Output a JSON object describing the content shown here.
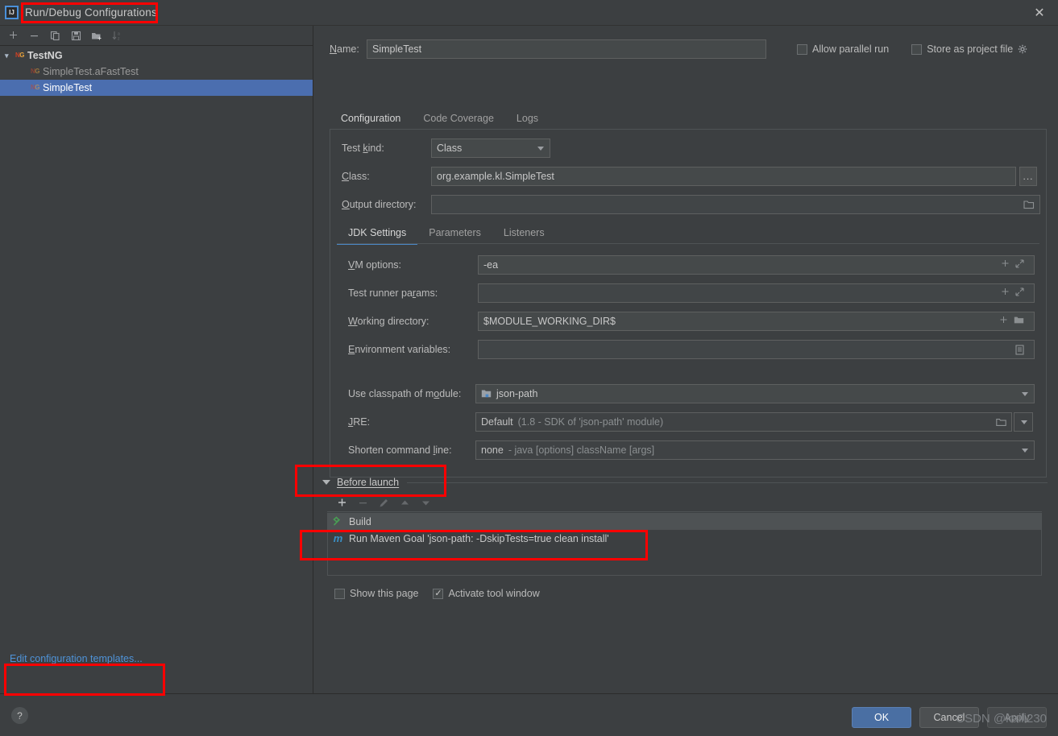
{
  "window": {
    "title": "Run/Debug Configurations",
    "logo_text": "IJ",
    "close_icon": "✕"
  },
  "sidebar": {
    "toolbar": [
      {
        "name": "add",
        "glyph": "+",
        "disabled": false
      },
      {
        "name": "remove",
        "glyph": "−",
        "disabled": false
      },
      {
        "name": "copy",
        "glyph": "copy",
        "disabled": false
      },
      {
        "name": "save",
        "glyph": "save",
        "disabled": false
      },
      {
        "name": "move-to-folder",
        "glyph": "folder-add",
        "disabled": false
      },
      {
        "name": "sort-alphabetically",
        "glyph": "sort-az",
        "disabled": true
      }
    ],
    "tree": [
      {
        "label": "TestNG",
        "level": 1,
        "selected": false,
        "expanded": true,
        "icon": "testng-icon"
      },
      {
        "label": "SimpleTest.aFastTest",
        "level": 2,
        "selected": false,
        "dim": true,
        "icon": "testng-icon"
      },
      {
        "label": "SimpleTest",
        "level": 2,
        "selected": true,
        "dim": false,
        "icon": "testng-icon"
      }
    ],
    "edit_templates_link": "Edit configuration templates..."
  },
  "header": {
    "name_label": "Name:",
    "name_value": "SimpleTest",
    "allow_parallel_run": {
      "label": "Allow parallel run",
      "checked": false
    },
    "store_as_project_file": {
      "label": "Store as project file",
      "checked": false,
      "gear_icon": "gear-icon"
    }
  },
  "tabs": [
    {
      "label": "Configuration",
      "active": true
    },
    {
      "label": "Code Coverage",
      "active": false
    },
    {
      "label": "Logs",
      "active": false
    }
  ],
  "configuration": {
    "test_kind": {
      "label": "Test kind:",
      "value": "Class"
    },
    "class": {
      "label": "Class:",
      "value": "org.example.kl.SimpleTest",
      "browse_label": "..."
    },
    "output_directory": {
      "label": "Output directory:",
      "value": "",
      "placeholder": ""
    },
    "sub_tabs": [
      {
        "label": "JDK Settings",
        "active": true
      },
      {
        "label": "Parameters",
        "active": false
      },
      {
        "label": "Listeners",
        "active": false
      }
    ],
    "vm_options": {
      "label": "VM options:",
      "value": "-ea"
    },
    "test_runner_params": {
      "label": "Test runner params:",
      "value": ""
    },
    "working_directory": {
      "label": "Working directory:",
      "value": "$MODULE_WORKING_DIR$"
    },
    "environment_variables": {
      "label": "Environment variables:",
      "value": ""
    },
    "use_classpath_of_module": {
      "label": "Use classpath of module:",
      "value": "json-path"
    },
    "jre": {
      "label": "JRE:",
      "value": "Default",
      "hint": "(1.8 - SDK of 'json-path' module)"
    },
    "shorten_command_line": {
      "label": "Shorten command line:",
      "value": "none",
      "hint": "- java [options] className [args]"
    }
  },
  "before_launch": {
    "title": "Before launch",
    "toolbar": [
      {
        "name": "add-task",
        "glyph": "+",
        "disabled": false
      },
      {
        "name": "remove-task",
        "glyph": "−",
        "disabled": true
      },
      {
        "name": "edit-task",
        "glyph": "pencil",
        "disabled": true
      },
      {
        "name": "move-up",
        "glyph": "up",
        "disabled": true
      },
      {
        "name": "move-down",
        "glyph": "down",
        "disabled": true
      }
    ],
    "tasks": [
      {
        "label": "Build",
        "icon": "build-hammer-icon"
      },
      {
        "label": "Run Maven Goal 'json-path: -DskipTests=true clean install'",
        "icon": "maven-icon"
      }
    ]
  },
  "bottom_options": {
    "show_this_page": {
      "label": "Show this page",
      "checked": false
    },
    "activate_tool_window": {
      "label": "Activate tool window",
      "checked": true
    }
  },
  "footer": {
    "help_glyph": "?",
    "ok_label": "OK",
    "cancel_label": "Cancel",
    "apply_label": "Apply"
  },
  "watermark": "CSDN @kaili230",
  "colors": {
    "accent_blue": "#4a88c7",
    "selection_blue": "#4b6eaf",
    "annotation_red": "#ff0000",
    "link_blue": "#4f93d8",
    "maven_blue": "#3a8fc4",
    "build_green": "#499c54"
  }
}
